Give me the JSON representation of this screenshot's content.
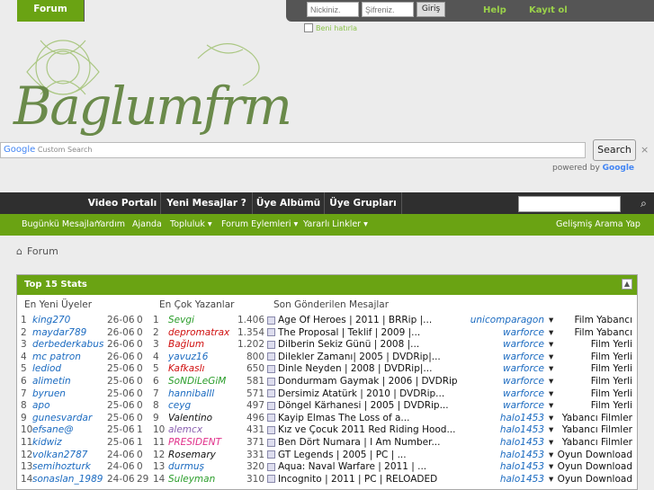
{
  "topbar": {
    "nick_placeholder": "Nickiniz.",
    "pass_placeholder": "Şifreniz.",
    "login_button": "Giriş",
    "help": "Help",
    "register": "Kayıt ol",
    "remember": "Beni hatırla"
  },
  "logo": {
    "text": "Baglumfrm"
  },
  "search": {
    "placeholder": "Custom Search",
    "google": "Google",
    "button": "Search",
    "clear": "×",
    "powered_by": "powered by",
    "powered_brand": "Google"
  },
  "nav": {
    "items": [
      "Forum",
      "Video Portalı",
      "Yeni Mesajlar ?",
      "Üye Albümü",
      "Üye Grupları"
    ]
  },
  "subnav": {
    "items": [
      "Bugünkü Mesajlar",
      "Yardım",
      "Ajanda",
      "Topluluk",
      "Forum Eylemleri",
      "Yararlı Linkler"
    ],
    "right": "Gelişmiş Arama Yap"
  },
  "breadcrumb": {
    "label": "Forum"
  },
  "stats": {
    "title": "Top 15 Stats",
    "col_new_members": "En Yeni Üyeler",
    "col_top_posters": "En Çok Yazanlar",
    "col_last_posts": "Son Gönderilen Mesajlar",
    "rows": [
      {
        "n": "1",
        "user": "king270",
        "date": "26-06",
        "c": "0",
        "n2": "1",
        "poster": "Sevgi",
        "pcolor": "#2a9d2a",
        "count": "1.406",
        "post": "Age Of Heroes | 2011 | BRRip |...",
        "author": "unicomparagon",
        "cat": "Film Yabancı"
      },
      {
        "n": "2",
        "user": "maydar789",
        "date": "26-06",
        "c": "0",
        "n2": "2",
        "poster": "depromatrax",
        "pcolor": "#d01010",
        "count": "1.354",
        "post": "The Proposal | Teklif | 2009 |...",
        "author": "warforce",
        "cat": "Film Yabancı"
      },
      {
        "n": "3",
        "user": "derbederkabus",
        "date": "26-06",
        "c": "0",
        "n2": "3",
        "poster": "Bağlum",
        "pcolor": "#d01010",
        "count": "1.202",
        "post": "Dilberin Sekiz Günü | 2008 |...",
        "author": "warforce",
        "cat": "Film Yerli"
      },
      {
        "n": "4",
        "user": "mc patron",
        "date": "26-06",
        "c": "0",
        "n2": "4",
        "poster": "yavuz16",
        "pcolor": "#1a6ac0",
        "count": "800",
        "post": "Dilekler Zamanı| 2005 | DVDRip|...",
        "author": "warforce",
        "cat": "Film Yerli"
      },
      {
        "n": "5",
        "user": "lediod",
        "date": "25-06",
        "c": "0",
        "n2": "5",
        "poster": "Kafkaslı",
        "pcolor": "#d01010",
        "count": "650",
        "post": "Dinle Neyden | 2008 | DVDRip|...",
        "author": "warforce",
        "cat": "Film Yerli"
      },
      {
        "n": "6",
        "user": "alimetin",
        "date": "25-06",
        "c": "0",
        "n2": "6",
        "poster": "SoNDiLeGiM",
        "pcolor": "#2a9d2a",
        "count": "581",
        "post": "Dondurmam Gaymak | 2006 | DVDRip...",
        "author": "warforce",
        "cat": "Film Yerli"
      },
      {
        "n": "7",
        "user": "byruen",
        "date": "25-06",
        "c": "0",
        "n2": "7",
        "poster": "hanniballl",
        "pcolor": "#1a6ac0",
        "count": "571",
        "post": "Dersimiz Atatürk | 2010 | DVDRip...",
        "author": "warforce",
        "cat": "Film Yerli"
      },
      {
        "n": "8",
        "user": "apo",
        "date": "25-06",
        "c": "0",
        "n2": "8",
        "poster": "ceyg",
        "pcolor": "#1a6ac0",
        "count": "497",
        "post": "Döngel Kärhanesi | 2005 | DVDRip...",
        "author": "warforce",
        "cat": "Film Yerli"
      },
      {
        "n": "9",
        "user": "gunesvardar",
        "date": "25-06",
        "c": "0",
        "n2": "9",
        "poster": "Valentino",
        "pcolor": "#111",
        "count": "496",
        "post": "Kayip Elmas The Loss of a...",
        "author": "halo1453",
        "cat": "Yabancı Filmler"
      },
      {
        "n": "10",
        "user": "efsane@",
        "date": "25-06",
        "c": "1",
        "n2": "10",
        "poster": "alemcx",
        "pcolor": "#8a5fb0",
        "count": "431",
        "post": "Kız ve Çocuk 2011 Red Riding Hood...",
        "author": "halo1453",
        "cat": "Yabancı Filmler"
      },
      {
        "n": "11",
        "user": "kidwiz",
        "date": "25-06",
        "c": "1",
        "n2": "11",
        "poster": "PRESIDENT",
        "pcolor": "#e0308a",
        "count": "371",
        "post": "Ben Dört Numara | I Am Number...",
        "author": "halo1453",
        "cat": "Yabancı Filmler"
      },
      {
        "n": "12",
        "user": "volkan2787",
        "date": "24-06",
        "c": "0",
        "n2": "12",
        "poster": "Rosemary",
        "pcolor": "#111",
        "count": "331",
        "post": "GT Legends | 2005 | PC | ...",
        "author": "halo1453",
        "cat": "Oyun Download"
      },
      {
        "n": "13",
        "user": "semihozturk",
        "date": "24-06",
        "c": "0",
        "n2": "13",
        "poster": "durmuş",
        "pcolor": "#1a6ac0",
        "count": "320",
        "post": "Aqua: Naval Warfare | 2011 | ...",
        "author": "halo1453",
        "cat": "Oyun Download"
      },
      {
        "n": "14",
        "user": "sonaslan_1989",
        "date": "24-06",
        "c": "29",
        "n2": "14",
        "poster": "Suleyman",
        "pcolor": "#2a9d2a",
        "count": "310",
        "post": "Incognito | 2011 | PC | RELOADED",
        "author": "halo1453",
        "cat": "Oyun Download"
      }
    ]
  }
}
